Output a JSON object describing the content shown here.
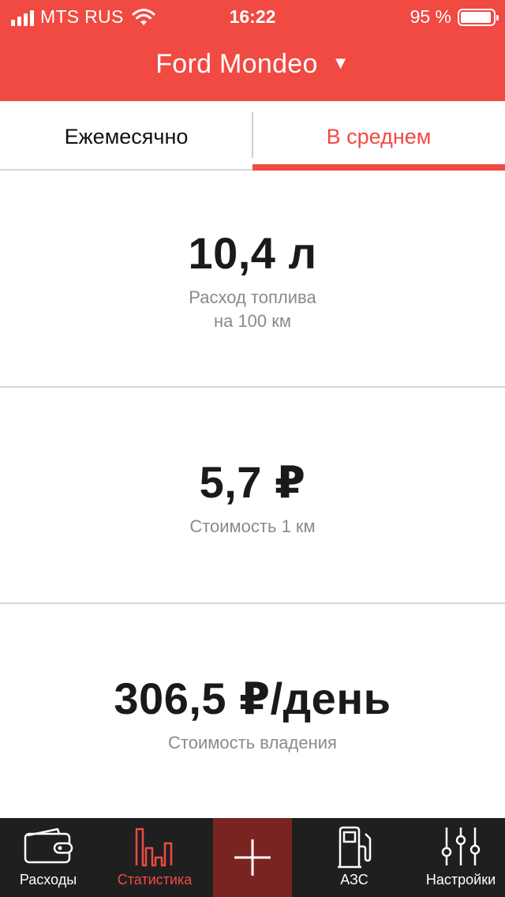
{
  "status_bar": {
    "carrier": "MTS RUS",
    "time": "16:22",
    "battery": "95 %"
  },
  "header": {
    "car_name": "Ford Mondeo",
    "caret": "▼"
  },
  "tabs": {
    "monthly": "Ежемесячно",
    "average": "В среднем",
    "active": "average"
  },
  "stats": [
    {
      "value": "10,4 л",
      "label_line1": "Расход топлива",
      "label_line2": "на 100 км"
    },
    {
      "value": "5,7 ₽",
      "label_line1": "Стоимость 1 км"
    },
    {
      "value": "306,5 ₽/день",
      "label_line1": "Стоимость владения"
    }
  ],
  "tabbar": {
    "expenses": {
      "label": "Расходы",
      "icon": "wallet-icon"
    },
    "statistics": {
      "label": "Статистика",
      "icon": "bar-chart-icon"
    },
    "add": {
      "icon": "plus-icon"
    },
    "gas_stations": {
      "label": "АЗС",
      "icon": "fuel-pump-icon"
    },
    "settings": {
      "label": "Настройки",
      "icon": "sliders-icon"
    }
  },
  "colors": {
    "accent": "#f04a42",
    "tabbar_bg": "#1f1f1f",
    "add_button_bg": "#7a2422"
  }
}
